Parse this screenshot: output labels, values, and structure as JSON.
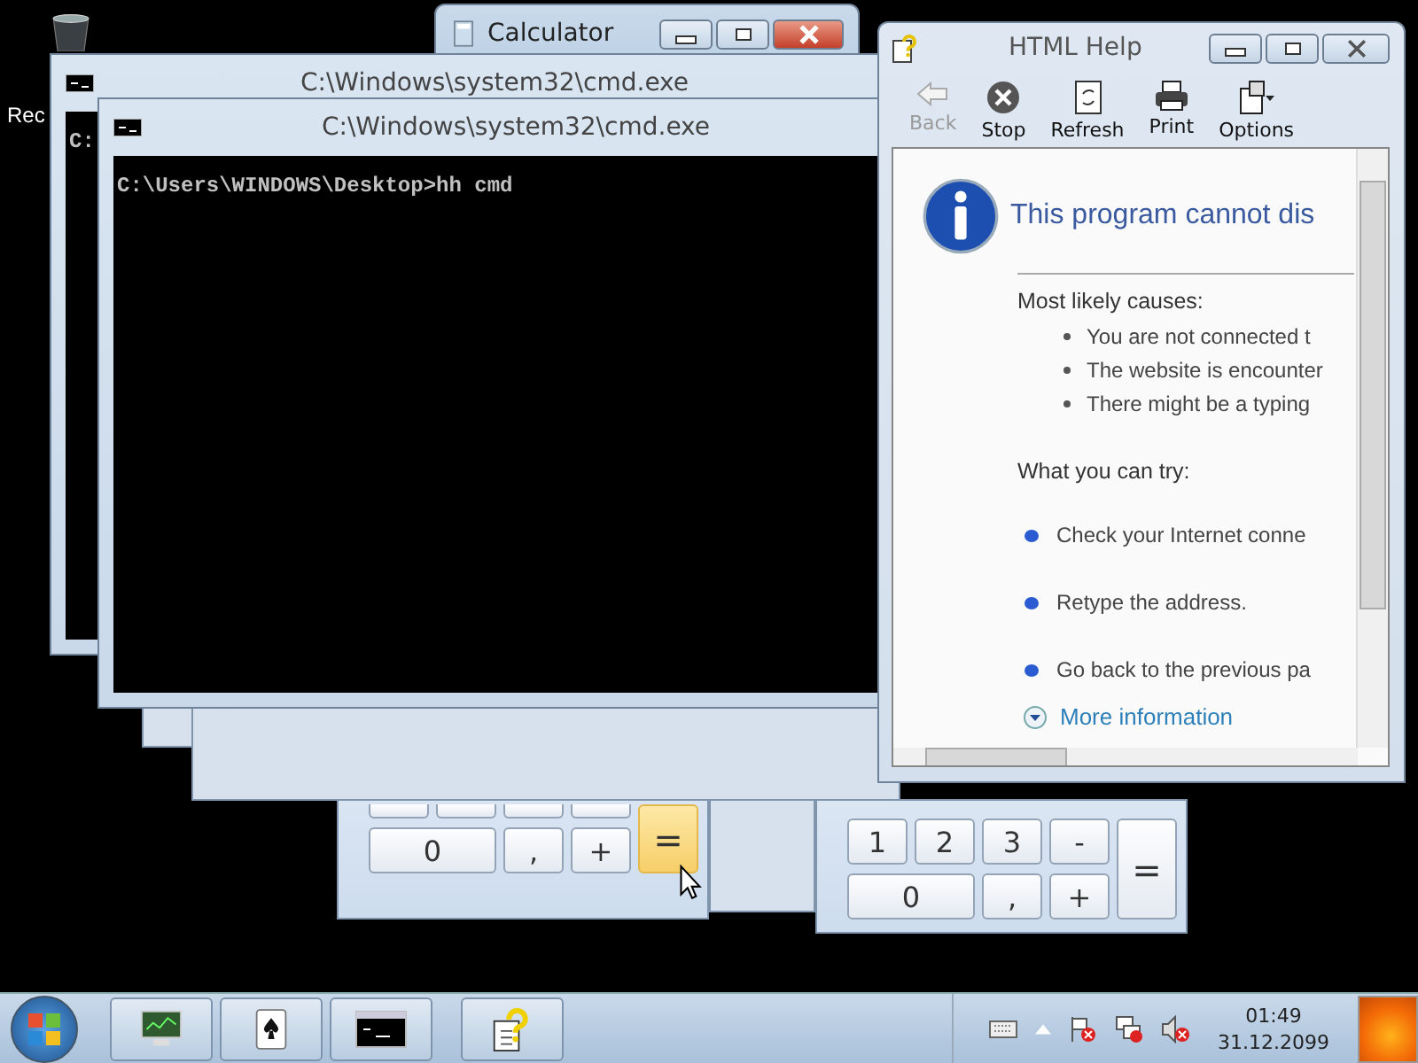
{
  "desktop_icons": [
    {
      "label": "Rec"
    }
  ],
  "calculator_window": {
    "title": "Calculator"
  },
  "calculators": [
    {
      "keys": [
        {
          "kind": "blank",
          "hovered": false
        },
        {
          "kind": "blank",
          "hovered": false
        },
        {
          "kind": "blank",
          "hovered": false
        },
        {
          "kind": "blank",
          "hovered": false
        },
        {
          "kind": "wide",
          "label": "0",
          "hovered": false
        },
        {
          "kind": "key",
          "label": ",",
          "hovered": false
        },
        {
          "kind": "key",
          "label": "+",
          "hovered": false
        },
        {
          "kind": "tall",
          "label": "=",
          "hovered": true
        }
      ]
    },
    {
      "keys": [
        {
          "kind": "key",
          "label": "1",
          "hovered": false
        },
        {
          "kind": "key",
          "label": "2",
          "hovered": false
        },
        {
          "kind": "key",
          "label": "3",
          "hovered": false
        },
        {
          "kind": "key",
          "label": "-",
          "hovered": false
        },
        {
          "kind": "wide",
          "label": "0",
          "hovered": false
        },
        {
          "kind": "key",
          "label": ",",
          "hovered": false
        },
        {
          "kind": "key",
          "label": "+",
          "hovered": false
        },
        {
          "kind": "tall",
          "label": "=",
          "hovered": false
        }
      ]
    }
  ],
  "console_windows": [
    {
      "title": "C:\\Windows\\system32\\cmd.exe",
      "lines": [
        "C:"
      ]
    },
    {
      "title": "C:\\Windows\\system32\\cmd.exe",
      "lines": [
        "C:\\Users\\WINDOWS\\Desktop>hh cmd"
      ]
    }
  ],
  "help_window": {
    "title": "HTML Help",
    "toolbar": [
      {
        "label": "Back",
        "kind": "back",
        "disabled": true
      },
      {
        "label": "Stop",
        "kind": "stop",
        "disabled": false
      },
      {
        "label": "Refresh",
        "kind": "refresh",
        "disabled": false
      },
      {
        "label": "Print",
        "kind": "print",
        "disabled": false
      },
      {
        "label": "Options",
        "kind": "options",
        "disabled": false
      }
    ],
    "heading": "This program cannot dis",
    "causes_title": "Most likely causes:",
    "causes": [
      "You are not connected t",
      "The website is encounter",
      "There might be a typing"
    ],
    "try_title": "What you can try:",
    "tries": [
      "Check your Internet conne",
      "Retype the address.",
      "Go back to the previous pa"
    ],
    "more_link": "More information"
  },
  "taskbar": {
    "buttons": [
      {
        "kind": "monitor"
      },
      {
        "kind": "cards"
      },
      {
        "kind": "console"
      },
      {
        "kind": "help"
      }
    ],
    "clock": {
      "time": "01:49",
      "date": "31.12.2099"
    }
  }
}
